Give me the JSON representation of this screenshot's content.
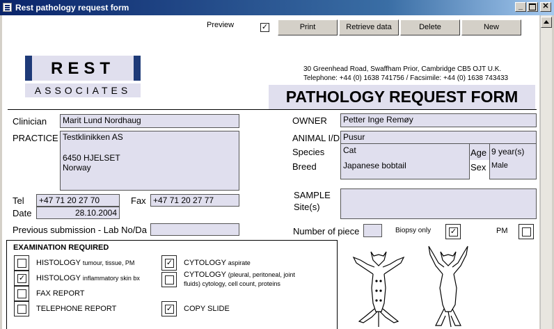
{
  "window": {
    "title": "Rest pathology request form"
  },
  "toolbar": {
    "preview_label": "Preview",
    "preview_checked": "✓",
    "print_label": "Print",
    "retrieve_label": "Retrieve data",
    "delete_label": "Delete",
    "new_label": "New"
  },
  "logo": {
    "line1": "REST",
    "line2": "ASSOCIATES"
  },
  "header": {
    "address": "30 Greenhead Road,  Swaffham Prior,  Cambridge  CB5 OJT  U.K.",
    "contact": "Telephone: +44 (0) 1638 741756 / Facsimile: +44 (0) 1638 743433",
    "form_title": "PATHOLOGY REQUEST FORM"
  },
  "fields": {
    "clinician_label": "Clinician",
    "clinician_value": "Marit Lund Nordhaug",
    "practice_label": "PRACTICE",
    "practice_line1": "Testklinikken AS",
    "practice_line2": "6450 HJELSET",
    "practice_line3": "Norway",
    "tel_label": "Tel",
    "tel_value": "+47 71 20 27 70",
    "fax_label": "Fax",
    "fax_value": "+47 71 20 27 77",
    "date_label": "Date",
    "date_value": "28.10.2004",
    "prev_sub_label": "Previous submission - Lab No/Da",
    "prev_sub_value": "",
    "owner_label": "OWNER",
    "owner_value": "Petter Inge Remøy",
    "animal_label": "ANIMAL I/D",
    "animal_value": "Pusur",
    "species_label": "Species",
    "species_value": "Cat",
    "breed_label": "Breed",
    "breed_value": "Japanese bobtail",
    "age_label": "Age",
    "age_value": "9 year(s)",
    "sex_label": "Sex",
    "sex_value": "Male",
    "sample_label": "SAMPLE",
    "sites_label": "Site(s)",
    "sample_value": "",
    "pieces_label": "Number of piece",
    "pieces_value": "",
    "biopsy_label": "Biopsy only",
    "biopsy_checked": "✓",
    "pm_label": "PM",
    "pm_checked": ""
  },
  "exam": {
    "heading": "EXAMINATION REQUIRED",
    "histology_tumour": "HISTOLOGY",
    "histology_tumour_sub": "tumour, tissue, PM",
    "histology_tumour_checked": "",
    "histology_inflam": "HISTOLOGY",
    "histology_inflam_sub": "inflammatory skin bx",
    "histology_inflam_checked": "✓",
    "fax_report": "FAX REPORT",
    "fax_report_checked": "",
    "tel_report": "TELEPHONE REPORT",
    "tel_report_checked": "",
    "cyto_aspirate": "CYTOLOGY",
    "cyto_aspirate_sub": "aspirate",
    "cyto_aspirate_checked": "✓",
    "cyto_fluids": "CYTOLOGY",
    "cyto_fluids_sub1": "(pleural, peritoneal, joint",
    "cyto_fluids_sub2": "fluids) cytology, cell count, proteins",
    "cyto_fluids_checked": "",
    "copy_slide": "COPY SLIDE",
    "copy_slide_checked": "✓"
  }
}
